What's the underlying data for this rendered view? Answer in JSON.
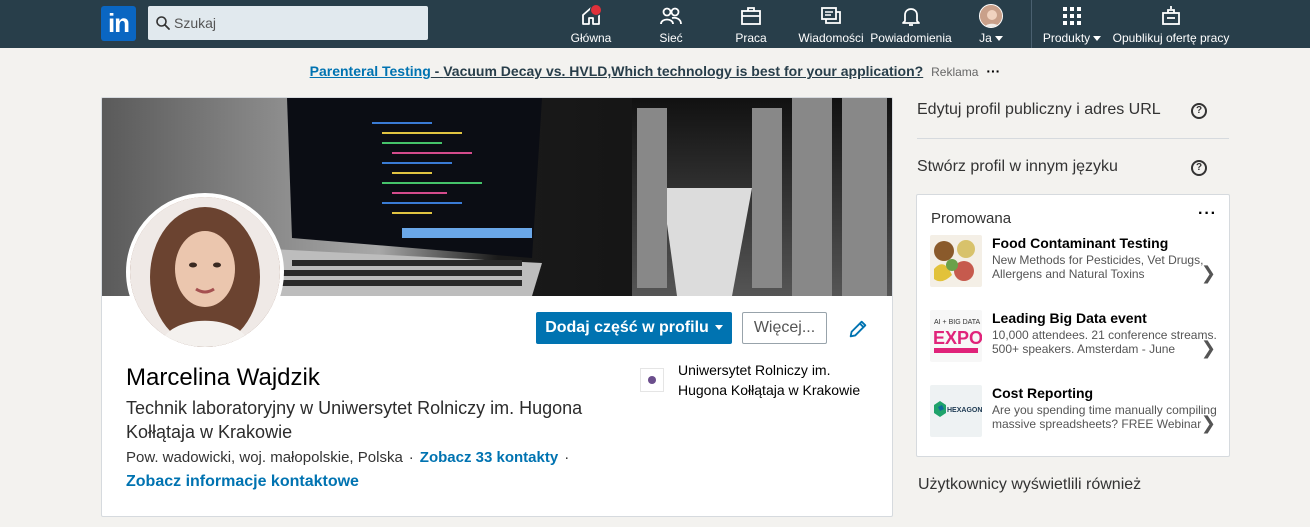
{
  "nav": {
    "search_placeholder": "Szukaj",
    "items": [
      {
        "label": "Główna",
        "icon": "home-icon"
      },
      {
        "label": "Sieć",
        "icon": "network-icon"
      },
      {
        "label": "Praca",
        "icon": "briefcase-icon"
      },
      {
        "label": "Wiadomości",
        "icon": "messages-icon"
      },
      {
        "label": "Powiadomienia",
        "icon": "bell-icon"
      },
      {
        "label": "Ja",
        "icon": "avatar"
      },
      {
        "label": "Produkty",
        "icon": "grid-icon"
      },
      {
        "label": "Opublikuj ofertę pracy",
        "icon": "post-job-icon"
      }
    ]
  },
  "ad": {
    "link": "Parenteral Testing",
    "dash": " - ",
    "text": "Vacuum Decay vs. HVLD,Which technology is best for your application?",
    "tag": "Reklama",
    "more": "···"
  },
  "profile": {
    "name": "Marcelina Wajdzik",
    "headline": "Technik laboratoryjny w Uniwersytet Rolniczy im. Hugona Kołłątaja w Krakowie",
    "location": "Pow. wadowicki, woj. małopolskie, Polska",
    "sep1": "·",
    "contacts": "Zobacz 33 kontakty",
    "sep2": "·",
    "contact_info": "Zobacz informacje kontaktowe",
    "add_section": "Dodaj część w profilu",
    "more": "Więcej...",
    "school": "Uniwersytet Rolniczy im. Hugona Kołłątaja w Krakowie"
  },
  "right": {
    "edit_public": "Edytuj profil publiczny i adres URL",
    "other_language": "Stwórz profil w innym języku",
    "help": "?",
    "promoted": "Promowana",
    "promoted_more": "···",
    "promos": [
      {
        "title": "Food Contaminant Testing",
        "desc": "New Methods for Pesticides, Vet Drugs, Allergens and Natural Toxins",
        "chev": "❯"
      },
      {
        "title": "Leading Big Data event",
        "desc": "10,000 attendees. 21 conference streams. 500+ speakers. Amsterdam - June",
        "chev": "❯"
      },
      {
        "title": "Cost Reporting",
        "desc": "Are you spending time manually compiling massive spreadsheets? FREE Webinar",
        "chev": "❯"
      }
    ],
    "also_viewed": "Użytkownicy wyświetlili również"
  },
  "colors": {
    "nav_bg": "#283e4a",
    "brand_blue": "#0073b1",
    "notif_red": "#e0303a"
  }
}
